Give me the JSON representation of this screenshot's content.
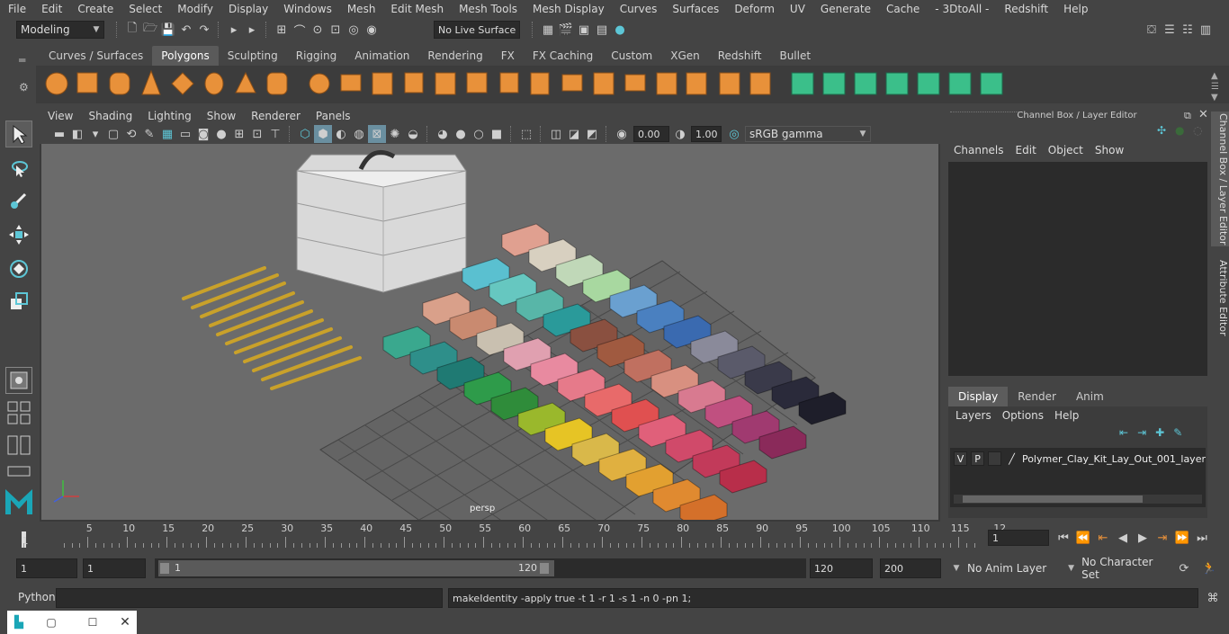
{
  "menubar": [
    "File",
    "Edit",
    "Create",
    "Select",
    "Modify",
    "Display",
    "Windows",
    "Mesh",
    "Edit Mesh",
    "Mesh Tools",
    "Mesh Display",
    "Curves",
    "Surfaces",
    "Deform",
    "UV",
    "Generate",
    "Cache",
    "- 3DtoAll -",
    "Redshift",
    "Help"
  ],
  "statusline": {
    "mode": "Modeling",
    "live_surface": "No Live Surface"
  },
  "shelf_tabs": [
    "Curves / Surfaces",
    "Polygons",
    "Sculpting",
    "Rigging",
    "Animation",
    "Rendering",
    "FX",
    "FX Caching",
    "Custom",
    "XGen",
    "Redshift",
    "Bullet"
  ],
  "shelf_active": "Polygons",
  "viewport": {
    "menu": [
      "View",
      "Shading",
      "Lighting",
      "Show",
      "Renderer",
      "Panels"
    ],
    "exposure": "0.00",
    "gamma": "1.00",
    "colorspace": "sRGB gamma",
    "camera_label": "persp"
  },
  "channelbox": {
    "title": "Channel Box / Layer Editor",
    "menu": [
      "Channels",
      "Edit",
      "Object",
      "Show"
    ],
    "layer_tabs": [
      "Display",
      "Render",
      "Anim"
    ],
    "layer_menu": [
      "Layers",
      "Options",
      "Help"
    ],
    "layer": {
      "v": "V",
      "p": "P",
      "name": "Polymer_Clay_Kit_Lay_Out_001_layer"
    }
  },
  "side_tabs": [
    "Channel Box / Layer Editor",
    "Attribute Editor"
  ],
  "timeline": {
    "ticks": [
      "1",
      "5",
      "10",
      "15",
      "20",
      "25",
      "30",
      "35",
      "40",
      "45",
      "50",
      "55",
      "60",
      "65",
      "70",
      "75",
      "80",
      "85",
      "90",
      "95",
      "100",
      "105",
      "110",
      "115",
      "12"
    ],
    "current_frame": "1"
  },
  "range": {
    "start": "1",
    "anim_start": "1",
    "slider_start": "1",
    "slider_end": "120",
    "end": "120",
    "anim_end": "200",
    "anim_layer": "No Anim Layer",
    "character_set": "No Character Set"
  },
  "cmdline": {
    "language": "Python",
    "result": "makeIdentity -apply true -t 1 -r 1 -s 1 -n 0 -pn 1;"
  },
  "colors": {
    "accent": "#5dc6d6",
    "shelf_orange": "#e8913a",
    "shelf_green": "#3bbf8a",
    "bg": "#444444",
    "field": "#2b2b2b"
  }
}
